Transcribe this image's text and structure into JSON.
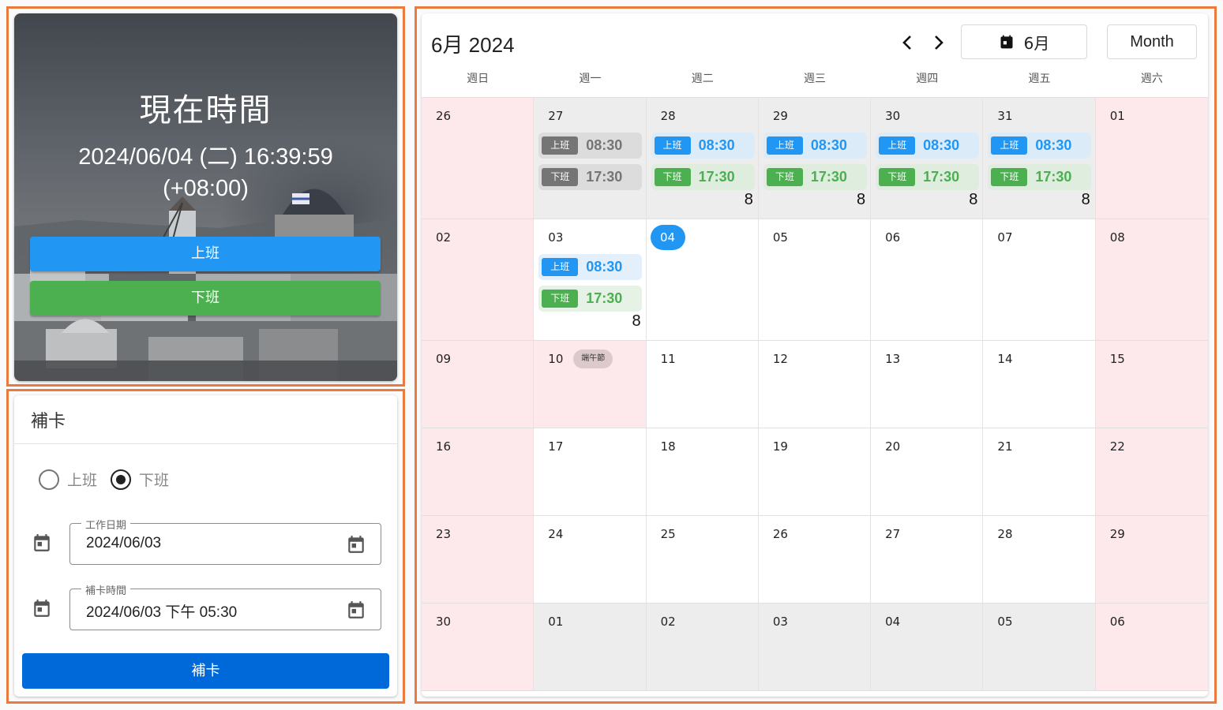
{
  "clock": {
    "title": "現在時間",
    "datetime": "2024/06/04 (二) 16:39:59",
    "timezone": "(+08:00)",
    "clock_in_label": "上班",
    "clock_out_label": "下班"
  },
  "makeup": {
    "title": "補卡",
    "radio_options": [
      {
        "label": "上班",
        "checked": false
      },
      {
        "label": "下班",
        "checked": true
      }
    ],
    "work_date": {
      "label": "工作日期",
      "value": "2024/06/03"
    },
    "punch_time": {
      "label": "補卡時間",
      "value": "2024/06/03 下午 05:30"
    },
    "submit_label": "補卡"
  },
  "calendar": {
    "title": "6月 2024",
    "month_picker_label": "6月",
    "view_mode_label": "Month",
    "weekdays": [
      "週日",
      "週一",
      "週二",
      "週三",
      "週四",
      "週五",
      "週六"
    ],
    "tag_in": "上班",
    "tag_out": "下班",
    "weeks": [
      [
        {
          "day": "26",
          "kind": "weekend"
        },
        {
          "day": "27",
          "kind": "other",
          "in": "08:30",
          "out": "17:30",
          "style": "grey"
        },
        {
          "day": "28",
          "kind": "other",
          "in": "08:30",
          "out": "17:30",
          "hours": "8"
        },
        {
          "day": "29",
          "kind": "other",
          "in": "08:30",
          "out": "17:30",
          "hours": "8"
        },
        {
          "day": "30",
          "kind": "other",
          "in": "08:30",
          "out": "17:30",
          "hours": "8"
        },
        {
          "day": "31",
          "kind": "other",
          "in": "08:30",
          "out": "17:30",
          "hours": "8"
        },
        {
          "day": "01",
          "kind": "weekend"
        }
      ],
      [
        {
          "day": "02",
          "kind": "weekend"
        },
        {
          "day": "03",
          "kind": "normal",
          "in": "08:30",
          "out": "17:30",
          "hours": "8",
          "light": true
        },
        {
          "day": "04",
          "kind": "normal",
          "today": true
        },
        {
          "day": "05",
          "kind": "normal"
        },
        {
          "day": "06",
          "kind": "normal"
        },
        {
          "day": "07",
          "kind": "normal"
        },
        {
          "day": "08",
          "kind": "weekend"
        }
      ],
      [
        {
          "day": "09",
          "kind": "weekend"
        },
        {
          "day": "10",
          "kind": "holiday",
          "holiday": "端午節"
        },
        {
          "day": "11",
          "kind": "normal"
        },
        {
          "day": "12",
          "kind": "normal"
        },
        {
          "day": "13",
          "kind": "normal"
        },
        {
          "day": "14",
          "kind": "normal"
        },
        {
          "day": "15",
          "kind": "weekend"
        }
      ],
      [
        {
          "day": "16",
          "kind": "weekend"
        },
        {
          "day": "17",
          "kind": "normal"
        },
        {
          "day": "18",
          "kind": "normal"
        },
        {
          "day": "19",
          "kind": "normal"
        },
        {
          "day": "20",
          "kind": "normal"
        },
        {
          "day": "21",
          "kind": "normal"
        },
        {
          "day": "22",
          "kind": "weekend"
        }
      ],
      [
        {
          "day": "23",
          "kind": "weekend"
        },
        {
          "day": "24",
          "kind": "normal"
        },
        {
          "day": "25",
          "kind": "normal"
        },
        {
          "day": "26",
          "kind": "normal"
        },
        {
          "day": "27",
          "kind": "normal"
        },
        {
          "day": "28",
          "kind": "normal"
        },
        {
          "day": "29",
          "kind": "weekend"
        }
      ],
      [
        {
          "day": "30",
          "kind": "weekend"
        },
        {
          "day": "01",
          "kind": "other"
        },
        {
          "day": "02",
          "kind": "other"
        },
        {
          "day": "03",
          "kind": "other"
        },
        {
          "day": "04",
          "kind": "other"
        },
        {
          "day": "05",
          "kind": "other"
        },
        {
          "day": "06",
          "kind": "weekend"
        }
      ]
    ]
  },
  "colors": {
    "frame": "#ea7a3e",
    "clock_in": "#2196f3",
    "clock_out": "#4caf50",
    "submit": "#0069d9",
    "weekend_bg": "#fde9eb",
    "other_month_bg": "#ededed"
  }
}
